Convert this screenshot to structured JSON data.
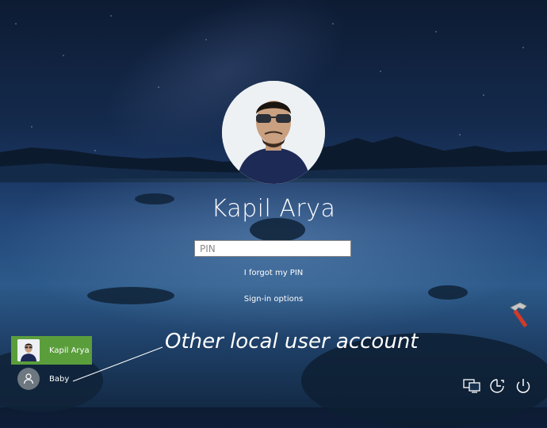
{
  "user": {
    "name": "Kapil Arya"
  },
  "pin_input": {
    "placeholder": "PIN"
  },
  "links": {
    "forgot_pin": "I forgot my PIN",
    "signin_options": "Sign-in options"
  },
  "user_tiles": [
    {
      "name": "Kapil Arya",
      "selected": true
    },
    {
      "name": "Baby",
      "selected": false
    }
  ],
  "annotation": "Other local user account",
  "system_icons": [
    "network-icon",
    "ease-of-access-icon",
    "power-icon"
  ],
  "colors": {
    "selected_tile": "#5a9e3c",
    "text": "#ffffff"
  }
}
